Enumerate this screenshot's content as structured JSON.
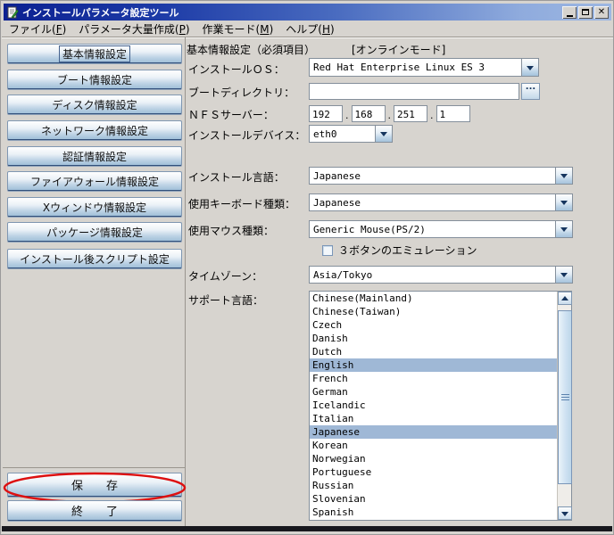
{
  "window": {
    "title": "インストールパラメータ設定ツール",
    "icon": "document-pencil-icon",
    "controls": {
      "minimize": "minimize",
      "maximize": "maximize",
      "close_glyph": "✕"
    }
  },
  "menu": {
    "items": [
      {
        "pre": "ファイル(",
        "key": "F",
        "post": ")"
      },
      {
        "pre": "パラメータ大量作成(",
        "key": "P",
        "post": ")"
      },
      {
        "pre": "作業モード(",
        "key": "M",
        "post": ")"
      },
      {
        "pre": "ヘルプ(",
        "key": "H",
        "post": ")"
      }
    ]
  },
  "sidebar": {
    "buttons": [
      "基本情報設定",
      "ブート情報設定",
      "ディスク情報設定",
      "ネットワーク情報設定",
      "認証情報設定",
      "ファイアウォール情報設定",
      "Xウィンドウ情報設定",
      "パッケージ情報設定",
      "インストール後スクリプト設定"
    ],
    "active": "基本情報設定"
  },
  "actions": {
    "save": "保　　存",
    "exit": "終　　了"
  },
  "annotation": {
    "shape": "ellipse",
    "target": "save-button",
    "color": "#dd1010"
  },
  "form": {
    "section_title": "基本情報設定（必須項目）",
    "mode_badge": "[オンラインモード]",
    "fields": {
      "os": {
        "label": "インストールＯＳ：",
        "value": "Red Hat Enterprise Linux ES 3"
      },
      "boot_dir": {
        "label": "ブートディレクトリ：",
        "value": "",
        "browse": "..."
      },
      "nfs": {
        "label": "ＮＦＳサーバー：",
        "octets": [
          "192",
          "168",
          "251",
          "1"
        ],
        "separator": "."
      },
      "device": {
        "label": "インストールデバイス：",
        "value": "eth0"
      },
      "language": {
        "label": "インストール言語：",
        "value": "Japanese"
      },
      "keyboard": {
        "label": "使用キーボード種類：",
        "value": "Japanese"
      },
      "mouse": {
        "label": "使用マウス種類：",
        "value": "Generic Mouse(PS/2)",
        "checkbox_label": "３ボタンのエミュレーション",
        "checkbox_checked": false
      },
      "timezone": {
        "label": "タイムゾーン：",
        "value": "Asia/Tokyo"
      },
      "support_languages": {
        "label": "サポート言語：",
        "items": [
          "Chinese(Mainland)",
          "Chinese(Taiwan)",
          "Czech",
          "Danish",
          "Dutch",
          "English",
          "French",
          "German",
          "Icelandic",
          "Italian",
          "Japanese",
          "Korean",
          "Norwegian",
          "Portuguese",
          "Russian",
          "Slovenian",
          "Spanish"
        ],
        "selected": [
          "English",
          "Japanese"
        ]
      }
    }
  },
  "colors": {
    "titlebar_start": "#0c2191",
    "titlebar_end": "#9db7e2",
    "button_face": "#bed3e5",
    "selection": "#9fb8d6",
    "annotation_red": "#dd1010",
    "background": "#d7d4cf"
  }
}
